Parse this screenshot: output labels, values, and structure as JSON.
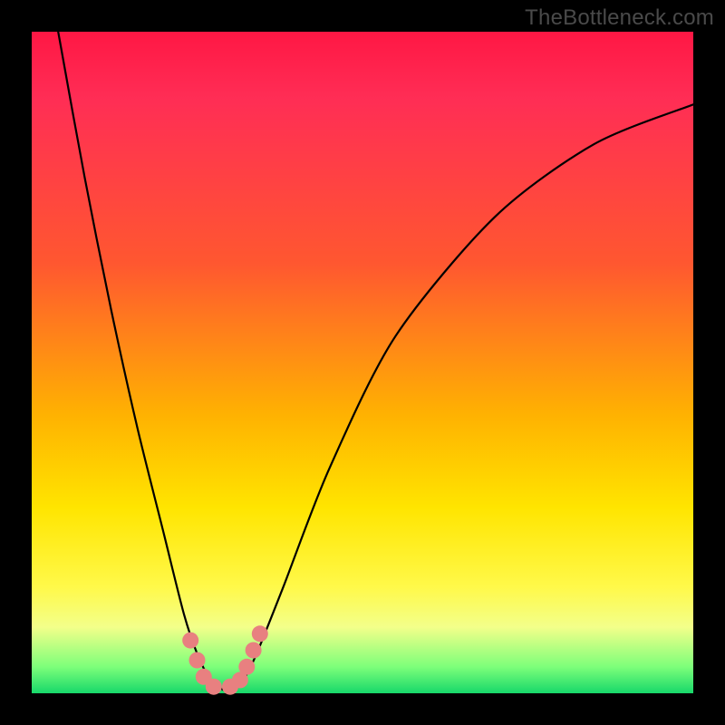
{
  "watermark": "TheBottleneck.com",
  "chart_data": {
    "type": "line",
    "title": "",
    "xlabel": "",
    "ylabel": "",
    "xlim": [
      0,
      100
    ],
    "ylim": [
      0,
      100
    ],
    "series": [
      {
        "name": "bottleneck-curve",
        "x": [
          4,
          8,
          12,
          16,
          20,
          23,
          25,
          27,
          29,
          30.5,
          32,
          34,
          38,
          45,
          55,
          70,
          85,
          100
        ],
        "y": [
          100,
          78,
          58,
          40,
          24,
          12,
          6,
          2,
          0.5,
          0.5,
          2,
          6,
          16,
          34,
          54,
          72,
          83,
          89
        ]
      }
    ],
    "markers": [
      {
        "x": 24.0,
        "y": 8.0
      },
      {
        "x": 25.0,
        "y": 5.0
      },
      {
        "x": 26.0,
        "y": 2.5
      },
      {
        "x": 27.5,
        "y": 1.0
      },
      {
        "x": 30.0,
        "y": 1.0
      },
      {
        "x": 31.5,
        "y": 2.0
      },
      {
        "x": 32.5,
        "y": 4.0
      },
      {
        "x": 33.5,
        "y": 6.5
      },
      {
        "x": 34.5,
        "y": 9.0
      }
    ],
    "gradient_stops": [
      {
        "pos": 0.0,
        "color": "#ff1744"
      },
      {
        "pos": 0.35,
        "color": "#ff5730"
      },
      {
        "pos": 0.72,
        "color": "#ffe500"
      },
      {
        "pos": 0.96,
        "color": "#7dff7a"
      },
      {
        "pos": 1.0,
        "color": "#17d86a"
      }
    ]
  }
}
